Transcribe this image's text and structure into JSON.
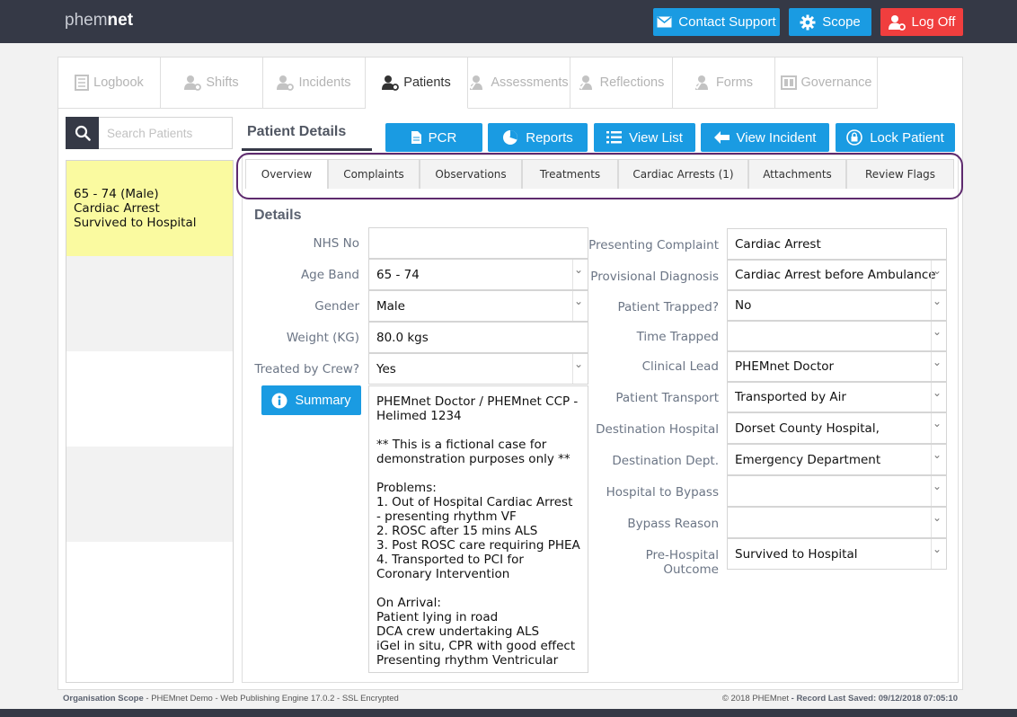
{
  "app": {
    "logo_light": "phem",
    "logo_bold": "net"
  },
  "header": {
    "contact_support": "Contact Support",
    "scope": "Scope",
    "log_off": "Log Off",
    "colors": {
      "blue": "#1a9be2",
      "red": "#f03e3e",
      "bar": "#353946"
    }
  },
  "main_tabs": [
    {
      "label": "Logbook",
      "icon": "logbook-icon"
    },
    {
      "label": "Shifts",
      "icon": "user-gear-icon"
    },
    {
      "label": "Incidents",
      "icon": "user-gear-icon"
    },
    {
      "label": "Patients",
      "icon": "user-gear-icon",
      "active": true
    },
    {
      "label": "Assessments",
      "icon": "user-check-icon"
    },
    {
      "label": "Reflections",
      "icon": "user-check-icon"
    },
    {
      "label": "Forms",
      "icon": "user-check-icon"
    },
    {
      "label": "Governance",
      "icon": "governance-icon"
    }
  ],
  "search": {
    "placeholder": "Search Patients"
  },
  "patients": [
    {
      "line1": "65 - 74 (Male)",
      "line2": "Cardiac Arrest",
      "line3": "Survived to Hospital",
      "highlight": "#fafaa0"
    }
  ],
  "patient_details": {
    "title": "Patient Details",
    "actions": {
      "pcr": "PCR",
      "reports": "Reports",
      "view_list": "View List",
      "view_incident": "View Incident",
      "lock_patient": "Lock Patient"
    },
    "tabs": [
      "Overview",
      "Complaints",
      "Observations",
      "Treatments",
      "Cardiac Arrests (1)",
      "Attachments",
      "Review Flags"
    ],
    "details_heading": "Details",
    "left_fields": [
      {
        "label": "NHS No",
        "value": ""
      },
      {
        "label": "Age Band",
        "value": "65 - 74"
      },
      {
        "label": "Gender",
        "value": "Male"
      },
      {
        "label": "Weight (KG)",
        "value": "80.0 kgs"
      },
      {
        "label": "Treated by Crew?",
        "value": "Yes"
      }
    ],
    "summary_button": "Summary",
    "summary_text": "PHEMnet Doctor / PHEMnet CCP - Helimed 1234\n\n** This is a fictional case for demonstration purposes only **\n\nProblems:\n1. Out of Hospital Cardiac Arrest - presenting rhythm VF\n2. ROSC after 15 mins ALS\n3. Post ROSC care requiring PHEA\n4. Transported to PCI for Coronary Intervention\n\nOn Arrival:\nPatient lying in road\nDCA crew undertaking ALS\niGel in situ, CPR with good effect\nPresenting rhythm Ventricular",
    "right_fields": [
      {
        "label": "Presenting Complaint",
        "value": "Cardiac Arrest"
      },
      {
        "label": "Provisional Diagnosis",
        "value": "Cardiac Arrest before Ambulance"
      },
      {
        "label": "Patient Trapped?",
        "value": "No"
      },
      {
        "label": "Time Trapped",
        "value": ""
      },
      {
        "label": "Clinical Lead",
        "value": "PHEMnet Doctor"
      },
      {
        "label": "Patient Transport",
        "value": "Transported by Air"
      },
      {
        "label": "Destination Hospital",
        "value": "Dorset County Hospital,"
      },
      {
        "label": "Destination Dept.",
        "value": "Emergency Department"
      },
      {
        "label": "Hospital to Bypass",
        "value": ""
      },
      {
        "label": "Bypass Reason",
        "value": ""
      },
      {
        "label": "Pre-Hospital Outcome",
        "value": "Survived to Hospital"
      }
    ]
  },
  "footer": {
    "scope_label": "Organisation Scope",
    "scope_text": " - PHEMnet Demo - Web Publishing Engine 17.0.2 - SSL Encrypted",
    "copyright": "© 2018 PHEMnet",
    "saved_label": " - Record Last Saved: 09/12/2018 07:05:10"
  }
}
